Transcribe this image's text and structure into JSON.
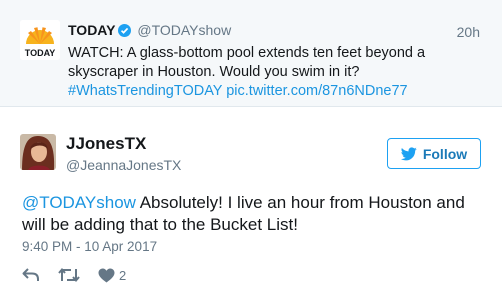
{
  "quoted_tweet": {
    "avatar_logo_text": "TODAY",
    "name": "TODAY",
    "handle": "@TODAYshow",
    "time": "20h",
    "text_main": "WATCH: A glass-bottom pool extends ten feet beyond a skyscraper in Houston. Would you swim in it?",
    "hashtag": "#WhatsTrendingTODAY",
    "link": "pic.twitter.com/87n6NDne77"
  },
  "reply_tweet": {
    "name": "JJonesTX",
    "handle": "@JeannaJonesTX",
    "follow_label": "Follow",
    "mention": "@TODAYshow",
    "text": " Absolutely! I live an hour from Houston and will be adding that to the Bucket List!",
    "timestamp": "9:40 PM - 10 Apr 2017",
    "like_count": "2"
  },
  "colors": {
    "link": "#1b95e0",
    "follow_border": "#1da1f2",
    "muted": "#657786",
    "today_orange": "#f7941d"
  },
  "icons": [
    "today-logo",
    "verified-icon",
    "twitter-bird-icon",
    "reply-icon",
    "retweet-icon",
    "heart-icon"
  ]
}
